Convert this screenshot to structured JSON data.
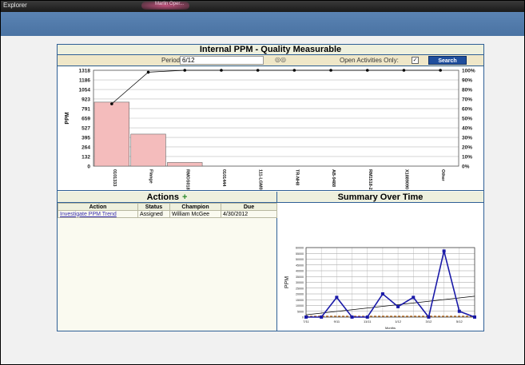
{
  "window": {
    "title": "Explorer",
    "tab_labels": [
      "Marlin Oper...",
      "",
      ""
    ]
  },
  "panel": {
    "title": "Internal PPM  - Quality Measurable",
    "period_label": "Period:",
    "period_value": "6/12",
    "open_only_label": "Open Activities Only:",
    "open_only_checked": "☑",
    "search_label": "Search"
  },
  "chart_data": [
    {
      "type": "bar",
      "categories": [
        "0101333",
        "Flange",
        "RMOS018",
        "0101444",
        "111-LGM0",
        "TR-NH8",
        "AB-9488",
        "RM1518-2",
        "X1889090",
        "Other"
      ],
      "values": [
        880,
        440,
        50,
        0,
        0,
        0,
        0,
        0,
        0,
        0
      ],
      "cumulative_percent": [
        65,
        98,
        100,
        100,
        100,
        100,
        100,
        100,
        100,
        100
      ],
      "ylabel": "PPM",
      "y_ticks": [
        0,
        132,
        264,
        395,
        527,
        659,
        791,
        923,
        1054,
        1186,
        1318
      ],
      "y2_ticks": [
        "0%",
        "10%",
        "20%",
        "30%",
        "40%",
        "50%",
        "60%",
        "70%",
        "80%",
        "90%",
        "100%"
      ],
      "ylim": [
        0,
        1318
      ],
      "bar_color": "#f4bcbc",
      "line_color": "#000000"
    },
    {
      "type": "line",
      "title": "Summary Over Time",
      "ylabel": "PPM",
      "xlabel": "Months",
      "x_ticks": [
        "7/11",
        "9/11",
        "11/11",
        "1/12",
        "3/12",
        "5/12"
      ],
      "y_ticks": [
        "0",
        "5000",
        "10000",
        "15000",
        "20000",
        "25000",
        "30000",
        "35000",
        "40000",
        "45000",
        "50000",
        "55000",
        "60000"
      ],
      "ylim": [
        0,
        60000
      ],
      "series": [
        {
          "values": [
            0,
            0,
            17000,
            0,
            0,
            20000,
            9000,
            17000,
            0,
            57000,
            5000,
            0
          ],
          "color": "#1a1aa8"
        }
      ],
      "trend": {
        "start": 2000,
        "end": 18000,
        "color": "#000000"
      },
      "baseline_color": "#b06010"
    }
  ],
  "actions": {
    "title": "Actions",
    "plus": "+",
    "headers": [
      "Action",
      "Status",
      "Champion",
      "Due"
    ],
    "rows": [
      {
        "action": "Investigate PPM Trend",
        "status": "Assigned",
        "champion": "William McGee",
        "due": "4/30/2012"
      }
    ]
  },
  "summary": {
    "title": "Summary Over Time"
  },
  "colors": {
    "accent": "#1f4e9c",
    "border": "#2e5f96",
    "header_bar": "#5a83b3"
  }
}
